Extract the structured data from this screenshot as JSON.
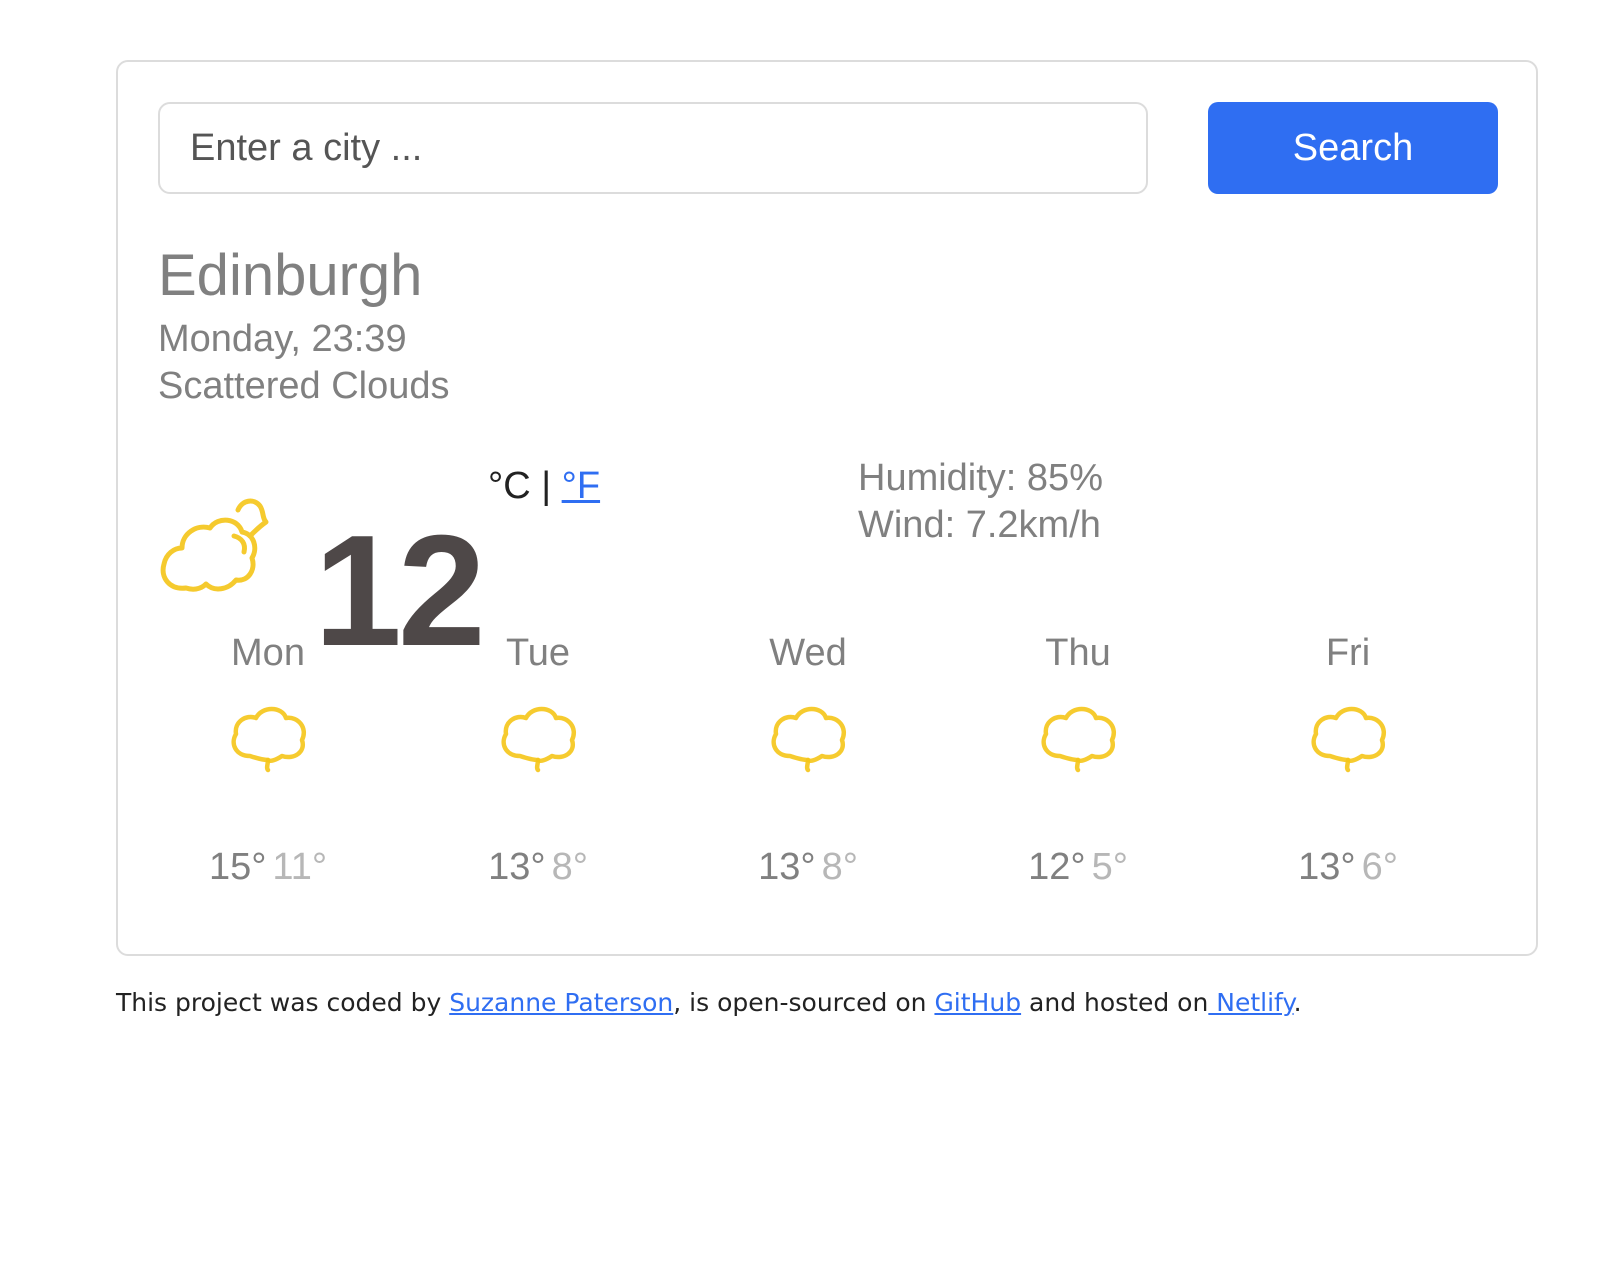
{
  "search": {
    "placeholder": "Enter a city ...",
    "button_label": "Search"
  },
  "current": {
    "city": "Edinburgh",
    "date": "Monday, 23:39",
    "description": "Scattered Clouds",
    "icon": "cloud-moon-icon",
    "temperature": "12",
    "unit_celsius": "°C",
    "unit_separator": "|",
    "unit_fahrenheit": "°F",
    "humidity": "Humidity: 85%",
    "wind": "Wind: 7.2km/h"
  },
  "forecast": [
    {
      "day": "Mon",
      "max": "15°",
      "min": "11°",
      "icon": "cloud-icon"
    },
    {
      "day": "Tue",
      "max": "13°",
      "min": "8°",
      "icon": "cloud-icon"
    },
    {
      "day": "Wed",
      "max": "13°",
      "min": "8°",
      "icon": "cloud-icon"
    },
    {
      "day": "Thu",
      "max": "12°",
      "min": "5°",
      "icon": "cloud-icon"
    },
    {
      "day": "Fri",
      "max": "13°",
      "min": "6°",
      "icon": "cloud-icon"
    }
  ],
  "footer": {
    "prefix": "This project was coded by ",
    "author": "Suzanne Paterson",
    "middle": ", is open-sourced on ",
    "github": "GitHub",
    "hosted": " and hosted on",
    "netlify": " Netlify",
    "suffix": "."
  },
  "colors": {
    "accent": "#2f6ef2",
    "icon_yellow": "#f5c518",
    "text_gray": "#808080",
    "temp_dark": "#4e4848"
  }
}
